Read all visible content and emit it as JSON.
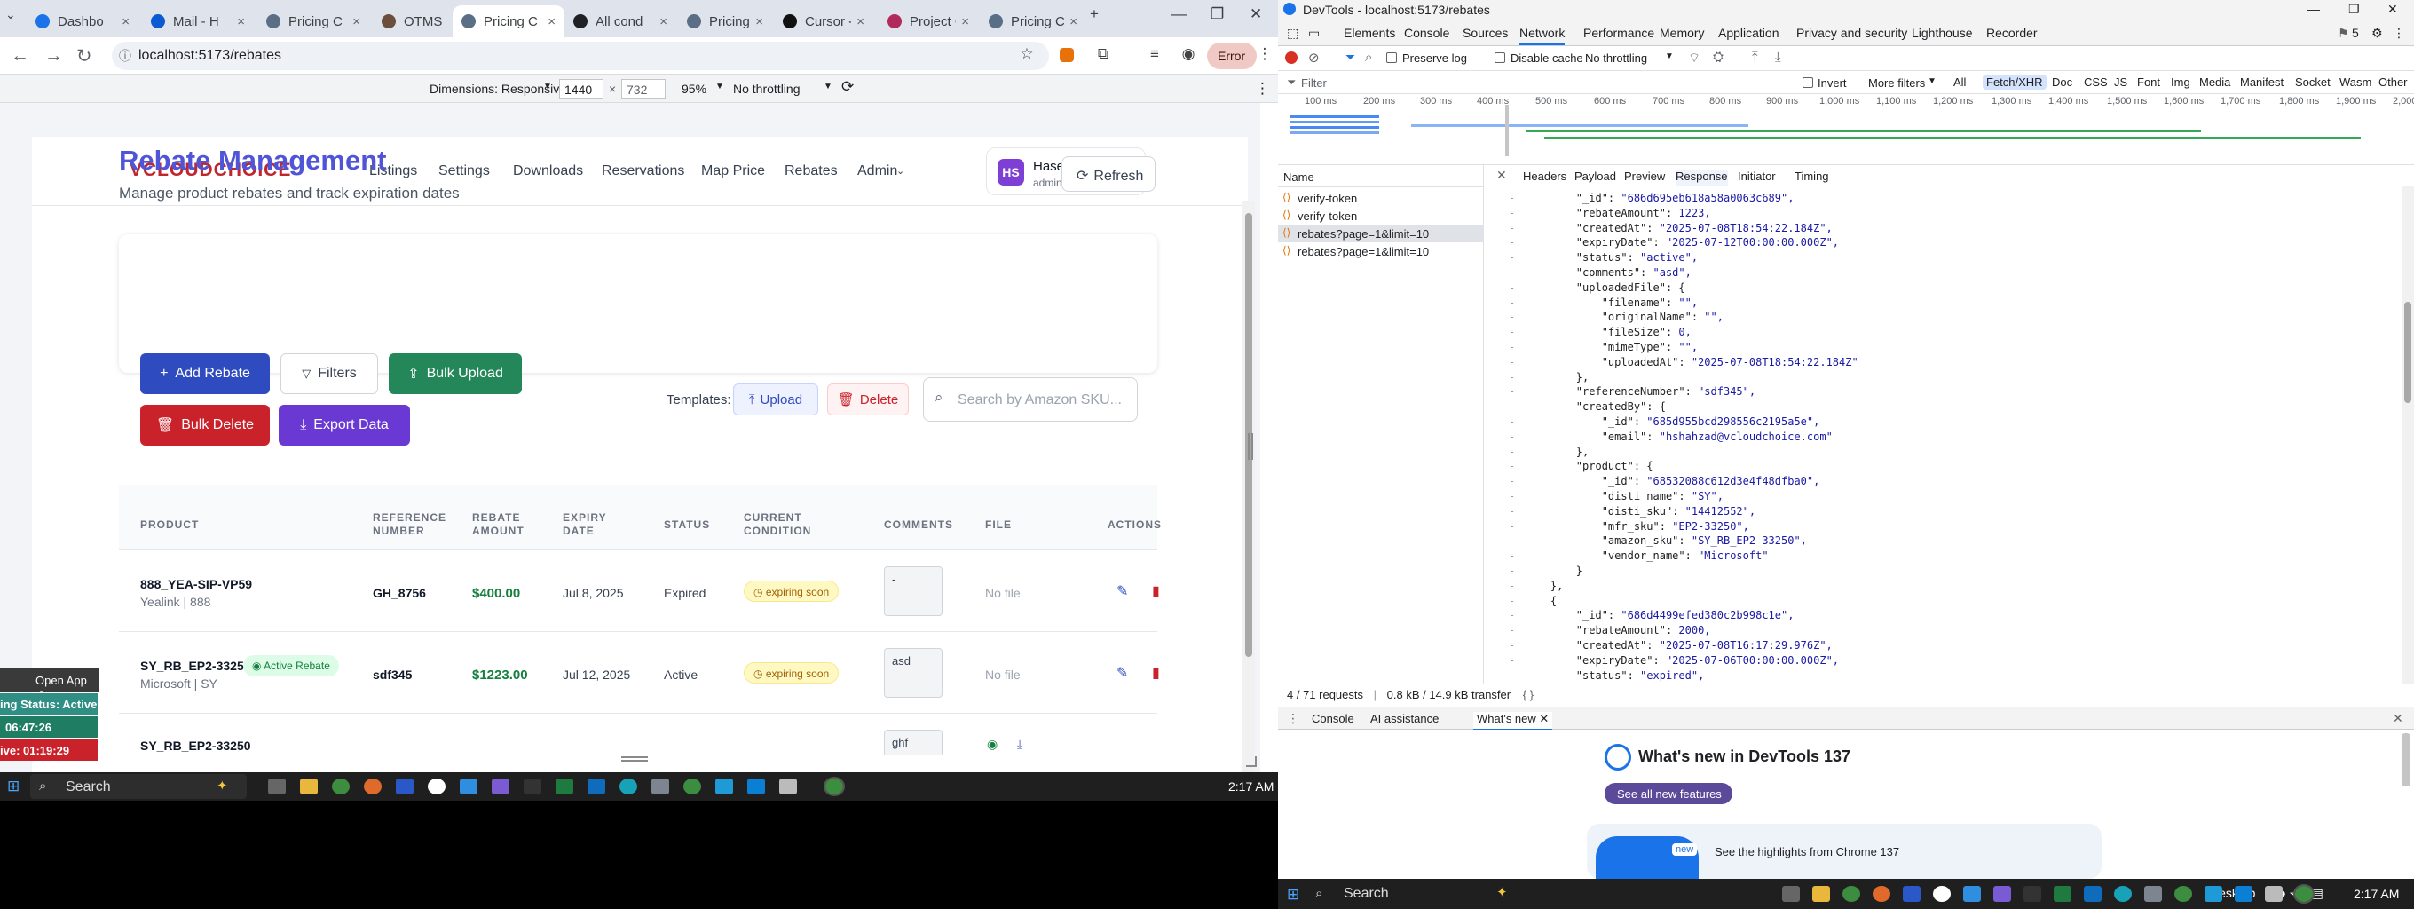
{
  "browser": {
    "tabs": [
      {
        "label": "Dashbo",
        "color": "#1a73e8"
      },
      {
        "label": "Mail - H",
        "color": "#0a5bd3"
      },
      {
        "label": "Pricing C",
        "color": "#5a6e86"
      },
      {
        "label": "OTMS",
        "color": "#6b4e3d"
      },
      {
        "label": "Pricing C",
        "color": "#5a6e86"
      },
      {
        "label": "All cond",
        "color": "#202124"
      },
      {
        "label": "Pricing C",
        "color": "#5a6e86"
      },
      {
        "label": "Cursor -",
        "color": "#111111"
      },
      {
        "label": "Project C",
        "color": "#b02a5c"
      },
      {
        "label": "Pricing C",
        "color": "#5a6e86"
      }
    ],
    "url": "localhost:5173/rebates",
    "error_label": "Error",
    "device_toolbar": {
      "dimensions_label": "Dimensions: Responsive",
      "width": "1440",
      "height": "732",
      "zoom": "95%",
      "throttle": "No throttling"
    }
  },
  "app": {
    "logo": "VCLOUDCHOICE",
    "nav": [
      "Listings",
      "Settings",
      "Downloads",
      "Reservations",
      "Map Price",
      "Rebates",
      "Admin"
    ],
    "user": {
      "initials": "HS",
      "name": "Haseeb Shah...",
      "role": "admin"
    },
    "title": "Rebate Management",
    "subtitle": "Manage product rebates and track expiration dates",
    "refresh_label": "Refresh",
    "buttons": {
      "add_rebate": "Add Rebate",
      "filters": "Filters",
      "bulk_upload": "Bulk Upload",
      "bulk_delete": "Bulk Delete",
      "export_data": "Export Data",
      "templates_label": "Templates:",
      "upload": "Upload",
      "delete": "Delete"
    },
    "search_placeholder": "Search by Amazon SKU...",
    "table": {
      "headers": {
        "product": "PRODUCT",
        "reference_number_l1": "REFERENCE",
        "reference_number_l2": "NUMBER",
        "rebate_amount_l1": "REBATE",
        "rebate_amount_l2": "AMOUNT",
        "expiry_date_l1": "EXPIRY",
        "expiry_date_l2": "DATE",
        "status": "STATUS",
        "current_condition_l1": "CURRENT",
        "current_condition_l2": "CONDITION",
        "comments": "COMMENTS",
        "file": "FILE",
        "actions": "ACTIONS"
      },
      "rows": [
        {
          "sku": "888_YEA-SIP-VP59",
          "sub": "Yealink | 888",
          "ref": "GH_8756",
          "amount": "$400.00",
          "expiry": "Jul 8, 2025",
          "status": "Expired",
          "condition": "expiring soon",
          "comment": "-",
          "file": "No file",
          "badge": ""
        },
        {
          "sku": "SY_RB_EP2-33250",
          "sub": "Microsoft | SY",
          "ref": "sdf345",
          "amount": "$1223.00",
          "expiry": "Jul 12, 2025",
          "status": "Active",
          "condition": "expiring soon",
          "comment": "asd",
          "file": "No file",
          "badge": "Active Rebate"
        },
        {
          "sku": "SY_RB_EP2-33250",
          "sub": "",
          "ref": "",
          "amount": "",
          "expiry": "",
          "status": "",
          "condition": "",
          "comment": "ghf",
          "file": "",
          "badge": ""
        }
      ]
    }
  },
  "overlay": {
    "open_app": "Open App",
    "status": "ing Status: Active",
    "timer1": "06:47:26",
    "timer2": "ive: 01:19:29"
  },
  "taskbar": {
    "search": "Search",
    "time": "2:17 AM",
    "desktop_label": "Desktop"
  },
  "devtools": {
    "title": "DevTools - localhost:5173/rebates",
    "panels": [
      "Elements",
      "Console",
      "Sources",
      "Network",
      "Performance",
      "Memory",
      "Application",
      "Privacy and security",
      "Lighthouse",
      "Recorder"
    ],
    "issues_count": "5",
    "net_toolbar": {
      "preserve_log": "Preserve log",
      "disable_cache": "Disable cache",
      "throttle": "No throttling"
    },
    "filter_placeholder": "Filter",
    "invert": "Invert",
    "more_filters": "More filters",
    "types": [
      "All",
      "Fetch/XHR",
      "Doc",
      "CSS",
      "JS",
      "Font",
      "Img",
      "Media",
      "Manifest",
      "Socket",
      "Wasm",
      "Other"
    ],
    "ticks": [
      "100 ms",
      "200 ms",
      "300 ms",
      "400 ms",
      "500 ms",
      "600 ms",
      "700 ms",
      "800 ms",
      "900 ms",
      "1,000 ms",
      "1,100 ms",
      "1,200 ms",
      "1,300 ms",
      "1,400 ms",
      "1,500 ms",
      "1,600 ms",
      "1,700 ms",
      "1,800 ms",
      "1,900 ms",
      "2,000"
    ],
    "name_header": "Name",
    "requests": [
      "verify-token",
      "verify-token",
      "rebates?page=1&limit=10",
      "rebates?page=1&limit=10"
    ],
    "detail_tabs": [
      "Headers",
      "Payload",
      "Preview",
      "Response",
      "Initiator",
      "Timing"
    ],
    "response_lines": [
      "        \"_id\": \"686d695eb618a58a0063c689\",",
      "        \"rebateAmount\": 1223,",
      "        \"createdAt\": \"2025-07-08T18:54:22.184Z\",",
      "        \"expiryDate\": \"2025-07-12T00:00:00.000Z\",",
      "        \"status\": \"active\",",
      "        \"comments\": \"asd\",",
      "        \"uploadedFile\": {",
      "            \"filename\": \"\",",
      "            \"originalName\": \"\",",
      "            \"fileSize\": 0,",
      "            \"mimeType\": \"\",",
      "            \"uploadedAt\": \"2025-07-08T18:54:22.184Z\"",
      "        },",
      "        \"referenceNumber\": \"sdf345\",",
      "        \"createdBy\": {",
      "            \"_id\": \"685d955bcd298556c2195a5e\",",
      "            \"email\": \"hshahzad@vcloudchoice.com\"",
      "        },",
      "        \"product\": {",
      "            \"_id\": \"68532088c612d3e4f48dfba0\",",
      "            \"disti_name\": \"SY\",",
      "            \"disti_sku\": \"14412552\",",
      "            \"mfr_sku\": \"EP2-33250\",",
      "            \"amazon_sku\": \"SY_RB_EP2-33250\",",
      "            \"vendor_name\": \"Microsoft\"",
      "        }",
      "    },",
      "    {",
      "        \"_id\": \"686d4499efed380c2b998c1e\",",
      "        \"rebateAmount\": 2000,",
      "        \"createdAt\": \"2025-07-08T16:17:29.976Z\",",
      "        \"expiryDate\": \"2025-07-06T00:00:00.000Z\",",
      "        \"status\": \"expired\","
    ],
    "status_summary": "4 / 71 requests",
    "transfer": "0.8 kB / 14.9 kB transfer",
    "drawer_tabs": [
      "Console",
      "AI assistance",
      "What's new"
    ],
    "whats_new_title": "What's new in DevTools 137",
    "see_all": "See all new features",
    "highlights": "See the highlights from Chrome 137",
    "new_badge": "new"
  },
  "colors": {
    "primary_blue": "#2e4bbf",
    "green": "#24875a",
    "red": "#c9222b",
    "purple": "#6a38d3",
    "accent_indigo": "#4f55d6"
  }
}
